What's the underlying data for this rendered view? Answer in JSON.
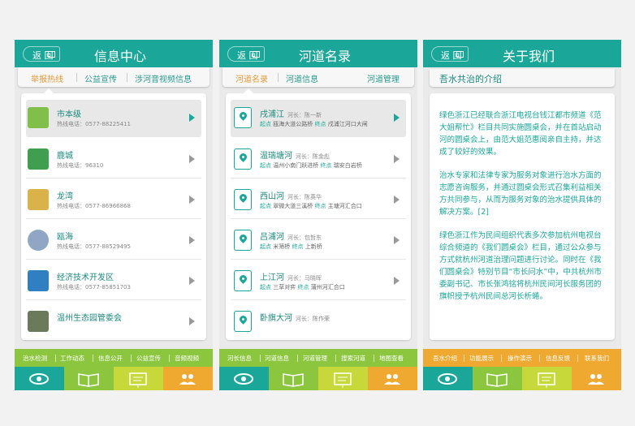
{
  "screens": [
    {
      "back_label": "返 回",
      "title": "信息中心",
      "tabs": [
        "举报热线",
        "公益宣传",
        "涉河音视频信息"
      ],
      "items": [
        {
          "name": "市本级",
          "hotline": "热线电话：0577-88225411"
        },
        {
          "name": "鹿城",
          "hotline": "热线电话：96310"
        },
        {
          "name": "龙湾",
          "hotline": "热线电话：0577-86966868"
        },
        {
          "name": "瓯海",
          "hotline": "热线电话：0577-88529495"
        },
        {
          "name": "经济技术开发区",
          "hotline": "热线电话：0577-85851703"
        },
        {
          "name": "温州生态园管委会",
          "hotline": ""
        }
      ],
      "bottom_links": [
        "治水检测",
        "工作动态",
        "信息公开",
        "公益宣传",
        "音频视频"
      ]
    },
    {
      "back_label": "返 回",
      "title": "河道名录",
      "tabs": [
        "河道名录",
        "河道信息",
        "河道管理"
      ],
      "rivers": [
        {
          "name": "戌浦江",
          "chief": "河长：陈一新",
          "start_label": "起点",
          "start": "瓯海大道公路桥",
          "end_label": "终点",
          "end": "戌浦江河口大闸"
        },
        {
          "name": "温瑞塘河",
          "chief": "河长：陈金彪",
          "start_label": "起点",
          "start": "温州小南门跃进桥",
          "end_label": "终点",
          "end": "瑞安白岩桥"
        },
        {
          "name": "西山河",
          "chief": "河长：陈英华",
          "start_label": "起点",
          "start": "翠微大道三溪桥",
          "end_label": "终点",
          "end": "主塘河汇合口"
        },
        {
          "name": "吕浦河",
          "chief": "河长：包哲东",
          "start_label": "起点",
          "start": "米筛桥",
          "end_label": "终点",
          "end": "上新桥"
        },
        {
          "name": "上江河",
          "chief": "河长：马晓晖",
          "start_label": "起点",
          "start": "三草对弈",
          "end_label": "终点",
          "end": "蒲州河汇合口"
        },
        {
          "name": "卧旗大河",
          "chief": "河长：陈作荣",
          "start_label": "",
          "start": "",
          "end_label": "",
          "end": ""
        }
      ],
      "bottom_links": [
        "河长信息",
        "河道信息",
        "河道管理",
        "搜索河道",
        "地图查看"
      ]
    },
    {
      "back_label": "返 回",
      "title": "关于我们",
      "section_title": "吾水共治的介绍",
      "paragraphs": [
        "绿色浙江已经联合浙江电视台钱江都市频道《范大姐帮忙》栏目共同实施圆桌会，并在首站启动河的圆桌会上，由范大姐范惠阅亲自主持，并达成了较好的效果。",
        "治水专家和法律专家为服务对象进行治水方面的志愿咨询服务，并通过圆桌会形式召集利益相关方共同参与，从而为服务对象的治水提供具体的解决方案。[2]",
        "绿色浙江作为民间组织代表多次参加杭州电视台综合频道的《我们圆桌会》栏目，通过公众参与方式就杭州河道治理问题进行讨论。同时在《我们圆桌会》特别节目“市长问水”中，中共杭州市委副书记、市长张鸿铭将杭州民间河长服务团的旗帜授予杭州民间总河长析蜷。"
      ],
      "bottom_links": [
        "吾水介绍",
        "功能展示",
        "操作演示",
        "信息反馈",
        "联系我们"
      ]
    }
  ],
  "colors": {
    "header": "#1aa79a",
    "green_bar": "#8cc63f",
    "orange_bar": "#f0a930",
    "icon_cells": [
      "#1aa79a",
      "#8cc63f",
      "#c6d83a",
      "#f0a930"
    ]
  },
  "bottom_icons": [
    "eye-icon",
    "book-icon",
    "board-icon",
    "people-icon"
  ]
}
